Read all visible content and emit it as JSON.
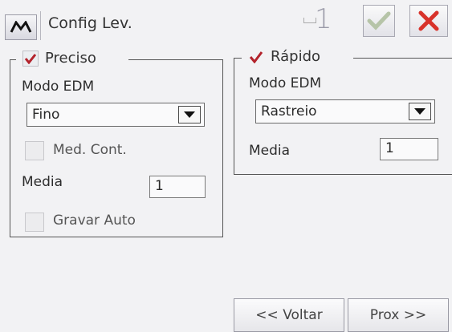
{
  "titlebar": {
    "logo_label": "M",
    "title": "Config Lev.",
    "indicator": "1",
    "ok_icon": "check-icon",
    "close_icon": "close-x-icon",
    "colors": {
      "ok": "#b8c8a8",
      "close": "#d8322a"
    }
  },
  "preciso": {
    "label": "Preciso",
    "checked": true,
    "modo_label": "Modo EDM",
    "modo_value": "Fino",
    "med_cont_label": "Med. Cont.",
    "media_label": "Media",
    "media_value": "1",
    "gravar_label": "Gravar Auto"
  },
  "rapido": {
    "label": "Rápido",
    "checked": true,
    "modo_label": "Modo EDM",
    "modo_value": "Rastreio",
    "media_label": "Media",
    "media_value": "1"
  },
  "footer": {
    "back_label": "<< Voltar",
    "next_label": "Prox >>"
  },
  "colors": {
    "check": "#b3232c"
  }
}
